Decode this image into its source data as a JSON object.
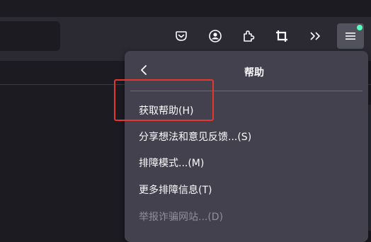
{
  "toolbar": {
    "icons": [
      "pocket-icon",
      "account-icon",
      "extensions-icon",
      "screenshot-icon",
      "overflow-icon",
      "app-menu-icon"
    ],
    "menu_badge_color": "#54ffbd"
  },
  "panel": {
    "title": "帮助",
    "items": [
      {
        "label": "获取帮助(H)",
        "enabled": true
      },
      {
        "label": "分享想法和意见反馈...(S)",
        "enabled": true
      },
      {
        "label": "排障模式...(M)",
        "enabled": true
      },
      {
        "label": "更多排障信息(T)",
        "enabled": true
      },
      {
        "label": "举报诈骗网站...(D)",
        "enabled": false
      }
    ]
  },
  "annotation": {
    "color": "#e6372f"
  }
}
